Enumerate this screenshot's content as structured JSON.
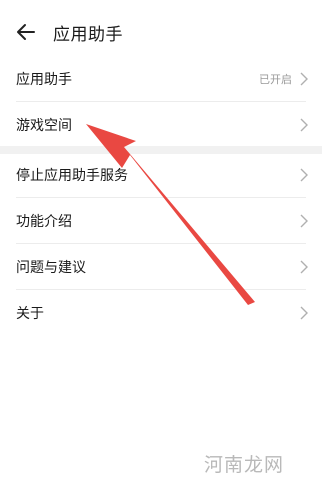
{
  "header": {
    "title": "应用助手"
  },
  "section1": [
    {
      "label": "应用助手",
      "status": "已开启"
    },
    {
      "label": "游戏空间",
      "status": ""
    }
  ],
  "section2": [
    {
      "label": "停止应用助手服务"
    },
    {
      "label": "功能介绍"
    },
    {
      "label": "问题与建议"
    },
    {
      "label": "关于"
    }
  ],
  "watermark": "河南龙网",
  "colors": {
    "annotation": "#e8413a",
    "divider": "#ececec",
    "muted": "#9a9a9a"
  }
}
